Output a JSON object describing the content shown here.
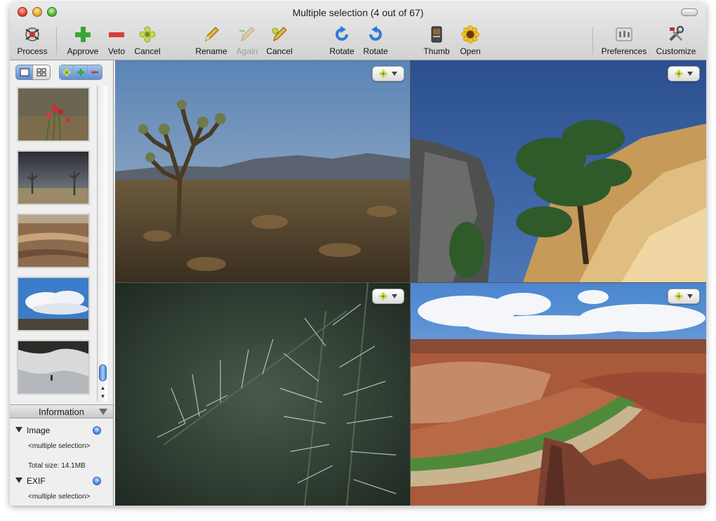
{
  "window": {
    "title": "Multiple selection (4 out of 67)"
  },
  "toolbar": {
    "process": {
      "label": "Process",
      "icon": "process-icon"
    },
    "approve": {
      "label": "Approve",
      "icon": "plus-icon"
    },
    "veto": {
      "label": "Veto",
      "icon": "minus-icon"
    },
    "cancel_flag": {
      "label": "Cancel",
      "icon": "flower-icon"
    },
    "rename": {
      "label": "Rename",
      "icon": "pencil-icon"
    },
    "again": {
      "label": "Again",
      "icon": "pencil-again-icon",
      "disabled": true
    },
    "cancel_rename": {
      "label": "Cancel",
      "icon": "pencil-cancel-icon"
    },
    "rotate_cw": {
      "label": "Rotate",
      "icon": "rotate-clockwise-icon"
    },
    "rotate_ccw": {
      "label": "Rotate",
      "icon": "rotate-counterclockwise-icon"
    },
    "thumb": {
      "label": "Thumb",
      "icon": "thumb-icon"
    },
    "open": {
      "label": "Open",
      "icon": "sunflower-icon"
    },
    "preferences": {
      "label": "Preferences",
      "icon": "preferences-icon"
    },
    "customize": {
      "label": "Customize",
      "icon": "tools-icon"
    }
  },
  "sidebar": {
    "view_modes": [
      "single-view-icon",
      "grid-view-icon"
    ],
    "flag_filters": [
      "flower-icon",
      "plus-icon",
      "minus-icon"
    ],
    "thumbnails": [
      {
        "subject": "red flowers"
      },
      {
        "subject": "storm over desert"
      },
      {
        "subject": "canyon layers"
      },
      {
        "subject": "clouds over plain"
      },
      {
        "subject": "snowy cave"
      }
    ]
  },
  "information": {
    "header": "Information",
    "image_section": {
      "title": "Image",
      "value": "<multiple selection>",
      "total_size": "Total size: 14.1MB"
    },
    "exif_section": {
      "title": "EXIF",
      "value": "<multiple selection>"
    }
  },
  "grid": {
    "images": [
      {
        "subject": "joshua-tree"
      },
      {
        "subject": "pine-on-cliff"
      },
      {
        "subject": "pine-needles"
      },
      {
        "subject": "canyon-river"
      }
    ]
  },
  "colors": {
    "accent": "#3c7ee0",
    "approve": "#3aa53a",
    "veto": "#d83a3a"
  }
}
